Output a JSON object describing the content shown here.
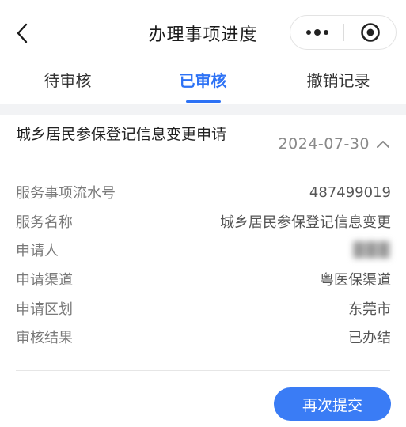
{
  "nav": {
    "title": "办理事项进度",
    "back_icon": "chevron-left-icon",
    "more_icon": "more-dots-icon",
    "close_icon": "target-close-icon"
  },
  "tabs": [
    {
      "label": "待审核",
      "active": false
    },
    {
      "label": "已审核",
      "active": true
    },
    {
      "label": "撤销记录",
      "active": false
    }
  ],
  "record": {
    "title": "城乡居民参保登记信息变更申请",
    "date": "2024-07-30",
    "toggle_icon": "chevron-up-icon",
    "fields": [
      {
        "label": "服务事项流水号",
        "value": "487499019"
      },
      {
        "label": "服务名称",
        "value": "城乡居民参保登记信息变更"
      },
      {
        "label": "申请人",
        "value": "███",
        "redacted": true
      },
      {
        "label": "申请渠道",
        "value": "粤医保渠道"
      },
      {
        "label": "申请区划",
        "value": "东莞市"
      },
      {
        "label": "审核结果",
        "value": "已办结"
      }
    ],
    "resubmit_label": "再次提交"
  },
  "colors": {
    "accent": "#2d72f5",
    "button": "#3a7cf5",
    "separator": "#f2f3f5"
  }
}
